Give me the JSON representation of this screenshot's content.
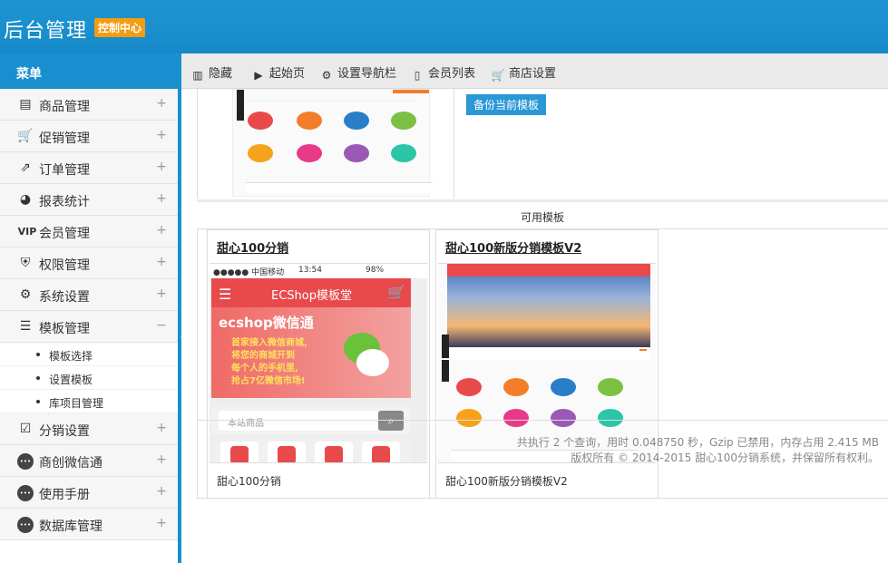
{
  "header": {
    "title": "后台管理",
    "badge": "控制中心"
  },
  "sidebar": {
    "menu_title": "菜单",
    "items": [
      {
        "label": "商品管理",
        "icon": "clipboard-icon",
        "glyph": "▤",
        "toggle": "+"
      },
      {
        "label": "促销管理",
        "icon": "cart-icon",
        "glyph": "🛒",
        "toggle": "+"
      },
      {
        "label": "订单管理",
        "icon": "external-link-icon",
        "glyph": "⇗",
        "toggle": "+"
      },
      {
        "label": "报表统计",
        "icon": "pie-chart-icon",
        "glyph": "◕",
        "toggle": "+"
      },
      {
        "label": "会员管理",
        "icon": "vip-icon",
        "glyph": "VIP",
        "toggle": "+"
      },
      {
        "label": "权限管理",
        "icon": "shield-icon",
        "glyph": "⛨",
        "toggle": "+"
      },
      {
        "label": "系统设置",
        "icon": "gears-icon",
        "glyph": "⚙",
        "toggle": "+"
      },
      {
        "label": "模板管理",
        "icon": "list-icon",
        "glyph": "☰",
        "toggle": "−"
      }
    ],
    "sub_items": [
      "模板选择",
      "设置模板",
      "库项目管理"
    ],
    "items_after": [
      {
        "label": "分销设置",
        "icon": "checkbox-icon",
        "glyph": "☑",
        "toggle": "+"
      },
      {
        "label": "商创微信通",
        "icon": "more-icon",
        "glyph": "•••",
        "toggle": "+"
      },
      {
        "label": "使用手册",
        "icon": "more-icon",
        "glyph": "•••",
        "toggle": "+"
      },
      {
        "label": "数据库管理",
        "icon": "more-icon",
        "glyph": "•••",
        "toggle": "+"
      }
    ]
  },
  "toolbar": {
    "hide": "隐藏",
    "start": "起始页",
    "nav": "设置导航栏",
    "members": "会员列表",
    "shop": "商店设置"
  },
  "content": {
    "backup_button": "备份当前模板",
    "available_title": "可用模板",
    "templates": [
      {
        "name": "甜心100分销",
        "caption": "甜心100分销",
        "status_carrier": "●●●●● 中国移动",
        "status_time": "13:54",
        "status_battery": "98%",
        "app_title": "ECShop模板堂",
        "banner_title": "ecshop微信通",
        "banner_lines": [
          "首家接入微信商城,",
          "将您的商城开到",
          "每个人的手机里,",
          "抢占7亿微信市场!"
        ],
        "search_placeholder": "本站商品"
      },
      {
        "name": "甜心100新版分销模板V2",
        "caption": "甜心100新版分销模板V2"
      }
    ]
  },
  "footer": {
    "line1": "共执行 2 个查询，用时 0.048750 秒，Gzip 已禁用，内存占用 2.415 MB",
    "line2": "版权所有 © 2014-2015 甜心100分销系统，并保留所有权利。"
  }
}
